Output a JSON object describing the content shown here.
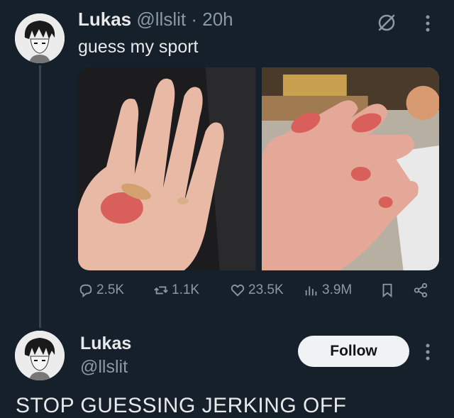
{
  "tweet": {
    "author_name": "Lukas",
    "author_handle": "@llslit",
    "separator": " · ",
    "time": "20h",
    "text": "guess my sport",
    "stats": {
      "replies": "2.5K",
      "reposts": "1.1K",
      "likes": "23.5K",
      "views": "3.9M"
    },
    "icons": [
      "grok-icon",
      "more-icon",
      "reply-icon",
      "repost-icon",
      "like-icon",
      "views-icon",
      "bookmark-icon",
      "share-icon"
    ]
  },
  "profile_card": {
    "name": "Lukas",
    "handle": "@llslit",
    "follow_label": "Follow",
    "bio": "STOP GUESSING JERKING OFF"
  },
  "colors": {
    "background": "#15202b",
    "text": "#e7e9ea",
    "muted": "#8b98a5",
    "button_bg": "#eff3f4"
  }
}
